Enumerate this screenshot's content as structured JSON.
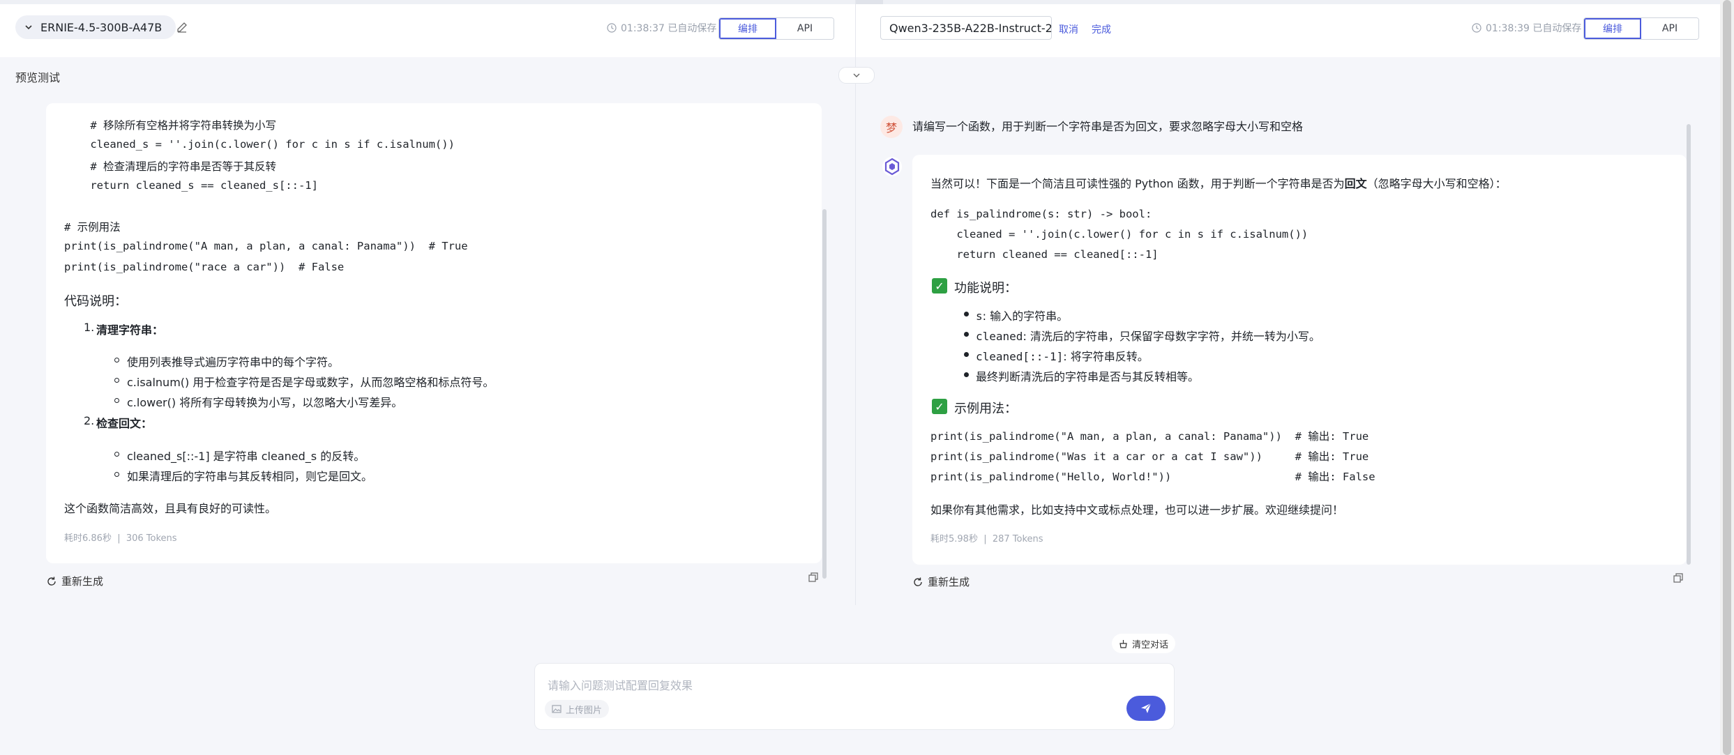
{
  "left": {
    "model_name": "ERNIE-4.5-300B-A47B",
    "saved_status": "01:38:37 已自动保存",
    "tab_arrange": "编排",
    "tab_api": "API",
    "code_pre": [
      "    # 移除所有空格并将字符串转换为小写",
      "    cleaned_s = ''.join(c.lower() for c in s if c.isalnum())",
      "    # 检查清理后的字符串是否等于其反转",
      "    return cleaned_s == cleaned_s[::-1]",
      "# 示例用法",
      "print(is_palindrome(\"A man, a plan, a canal: Panama\"))  # True",
      "print(is_palindrome(\"race a car\"))  # False"
    ],
    "explain_title": "代码说明：",
    "section1_num": "1.",
    "section1_title": "清理字符串：",
    "section1_items": [
      "使用列表推导式遍历字符串中的每个字符。",
      "c.isalnum() 用于检查字符是否是字母或数字，从而忽略空格和标点符号。",
      "c.lower() 将所有字母转换为小写，以忽略大小写差异。"
    ],
    "section2_num": "2.",
    "section2_title": "检查回文：",
    "section2_items": [
      "cleaned_s[::-1] 是字符串 cleaned_s 的反转。",
      "如果清理后的字符串与其反转相同，则它是回文。"
    ],
    "summary": "这个函数简洁高效，且具有良好的可读性。",
    "meta": "耗时6.86秒  |  306 Tokens",
    "regen": "重新生成"
  },
  "right": {
    "model_name": "Qwen3-235B-A22B-Instruct-2",
    "cancel": "取消",
    "done": "完成",
    "saved_status": "01:38:39 已自动保存",
    "tab_arrange": "编排",
    "tab_api": "API",
    "user_avatar": "梦",
    "user_question": "请编写一个函数，用于判断一个字符串是否为回文，要求忽略字母大小写和空格",
    "intro_a": "当然可以！下面是一个简洁且可读性强的 Python 函数，用于判断一个字符串是否为",
    "intro_bold": "回文",
    "intro_b": "（忽略字母大小写和空格）：",
    "code1": [
      "def is_palindrome(s: str) -> bool:",
      "    cleaned = ''.join(c.lower() for c in s if c.isalnum())",
      "    return cleaned == cleaned[::-1]"
    ],
    "func_title": "功能说明：",
    "func_items": [
      {
        "code": "s",
        "text": ": 输入的字符串。"
      },
      {
        "code": "cleaned",
        "text": ": 清洗后的字符串，只保留字母数字字符，并统一转为小写。"
      },
      {
        "code": "cleaned[::-1]",
        "text": ": 将字符串反转。"
      },
      {
        "code": "",
        "text": "最终判断清洗后的字符串是否与其反转相等。"
      }
    ],
    "usage_title": "示例用法：",
    "code2": [
      "print(is_palindrome(\"A man, a plan, a canal: Panama\"))  # 输出: True",
      "print(is_palindrome(\"Was it a car or a cat I saw\"))     # 输出: True",
      "print(is_palindrome(\"Hello, World!\"))                   # 输出: False"
    ],
    "closing": "如果你有其他需求，比如支持中文或标点处理，也可以进一步扩展。欢迎继续提问！",
    "meta": "耗时5.98秒  |  287 Tokens",
    "regen": "重新生成"
  },
  "preview_title": "预览测试",
  "clear_chat": "清空对话",
  "input_placeholder": "请输入问题测试配置回复效果",
  "upload_image": "上传图片",
  "colors": {
    "accent": "#4b5bdc",
    "check_green": "#2ea043"
  }
}
